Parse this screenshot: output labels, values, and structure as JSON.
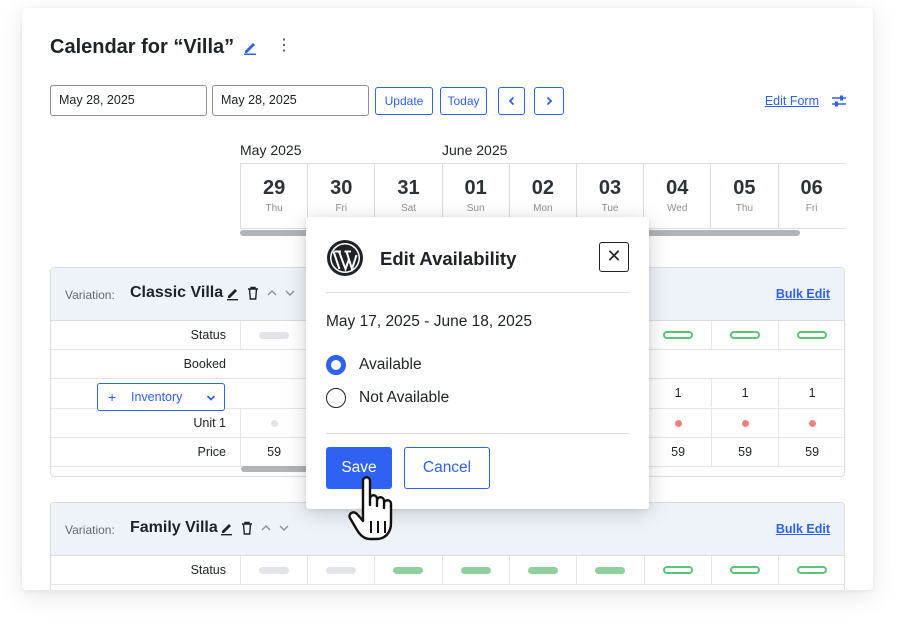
{
  "header": {
    "title": "Calendar for “Villa”",
    "start_date": "May 28, 2025",
    "end_date": "May 28, 2025",
    "update_label": "Update",
    "today_label": "Today",
    "prev_icon": "chevron-left-icon",
    "next_icon": "chevron-right-icon",
    "edit_form_label": "Edit Form"
  },
  "months": [
    "May 2025",
    "June 2025"
  ],
  "dates": [
    {
      "num": "29",
      "dow": "Thu"
    },
    {
      "num": "30",
      "dow": "Fri"
    },
    {
      "num": "31",
      "dow": "Sat"
    },
    {
      "num": "01",
      "dow": "Sun"
    },
    {
      "num": "02",
      "dow": "Mon"
    },
    {
      "num": "03",
      "dow": "Tue"
    },
    {
      "num": "04",
      "dow": "Wed"
    },
    {
      "num": "05",
      "dow": "Thu"
    },
    {
      "num": "06",
      "dow": "Fri"
    }
  ],
  "variations": [
    {
      "prefix": "Variation:",
      "name": "Classic Villa",
      "bulk_edit": "Bulk Edit",
      "rows": {
        "status": "Status",
        "booked": "Booked",
        "inventory": "Inventory",
        "unit": "Unit 1",
        "price": "Price"
      },
      "inventory_values": [
        "1",
        "1",
        "1"
      ],
      "prices": [
        "59",
        "59",
        "59",
        "59"
      ]
    },
    {
      "prefix": "Variation:",
      "name": "Family Villa",
      "bulk_edit": "Bulk Edit",
      "rows": {
        "status": "Status"
      }
    }
  ],
  "modal": {
    "title": "Edit Availability",
    "logo": "wordpress-logo",
    "range": "May 17, 2025 - June 18, 2025",
    "options": [
      "Available",
      "Not Available"
    ],
    "selected": "Available",
    "save_label": "Save",
    "cancel_label": "Cancel",
    "close_glyph": "✕"
  },
  "colors": {
    "accent": "#2f62f3",
    "available_green": "#8fd19e",
    "blocked_red": "#f08080",
    "header_bg": "#eef3fa"
  }
}
